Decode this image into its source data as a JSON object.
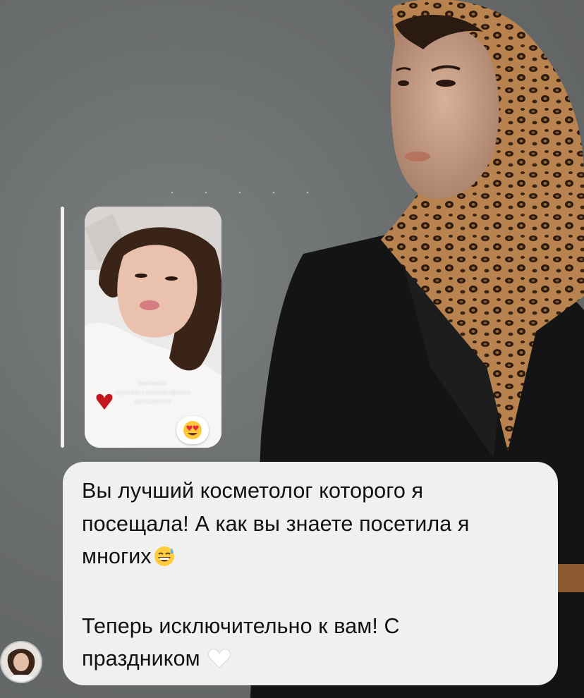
{
  "chat": {
    "story_reply": {
      "caption_lines": [
        "Замечание-",
        "перейти к услугам другого",
        "косметолога"
      ],
      "reaction": "heart-eyes-emoji"
    },
    "message": {
      "line1": "Вы лучший косметолог которого я",
      "line2": "посещала! А как вы знаете посетила я",
      "line3": "многих",
      "line3_emoji": "grinning-sweat-emoji",
      "line4": "Теперь исключительно к вам! С",
      "line5": "праздником",
      "line5_emoji": "white-heart-emoji"
    }
  },
  "colors": {
    "background": "#6b6e6e",
    "bubble": "#f0f0f0",
    "text": "#111111"
  }
}
